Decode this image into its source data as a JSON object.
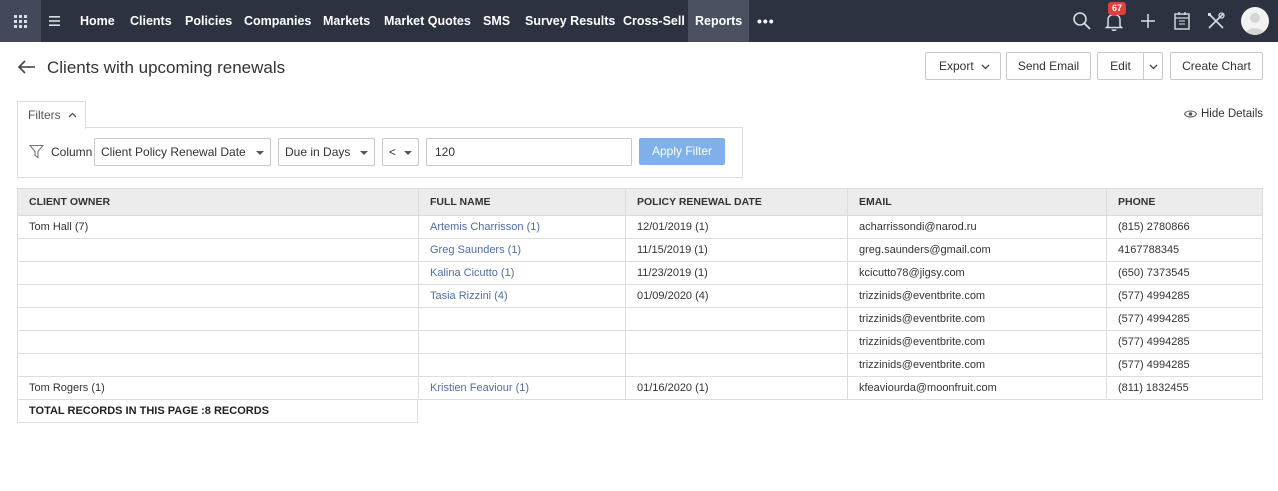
{
  "nav": {
    "items": [
      {
        "label": "Home"
      },
      {
        "label": "Clients"
      },
      {
        "label": "Policies"
      },
      {
        "label": "Companies"
      },
      {
        "label": "Markets"
      },
      {
        "label": "Market Quotes"
      },
      {
        "label": "SMS"
      },
      {
        "label": "Survey Results"
      },
      {
        "label": "Cross-Sell"
      },
      {
        "label": "Reports",
        "active": true
      }
    ],
    "more": "•••",
    "notification_count": "67",
    "colors": {
      "bar": "#2d3241",
      "active": "#4a5060",
      "badge": "#e0403a"
    }
  },
  "header": {
    "title": "Clients with upcoming renewals",
    "buttons": {
      "export": "Export",
      "send_email": "Send Email",
      "edit": "Edit",
      "create_chart": "Create Chart"
    }
  },
  "filters": {
    "tab_label": "Filters",
    "column_label": "Column",
    "column_select": "Client Policy Renewal Date",
    "condition_select": "Due in Days",
    "operator_select": "<",
    "value": "120",
    "apply_label": "Apply Filter",
    "hide_details": "Hide Details"
  },
  "table": {
    "columns": [
      "CLIENT OWNER",
      "FULL NAME",
      "POLICY RENEWAL DATE",
      "EMAIL",
      "PHONE"
    ],
    "rows": [
      [
        "Tom Hall (7)",
        "Artemis Charrisson (1)",
        "12/01/2019 (1)",
        "acharrissondi@narod.ru",
        "(815) 2780866"
      ],
      [
        "",
        "Greg Saunders (1)",
        "11/15/2019 (1)",
        "greg.saunders@gmail.com",
        "4167788345"
      ],
      [
        "",
        "Kalina Cicutto (1)",
        "11/23/2019 (1)",
        "kcicutto78@jigsy.com",
        "(650) 7373545"
      ],
      [
        "",
        "Tasia Rizzini (4)",
        "01/09/2020 (4)",
        "trizzinids@eventbrite.com",
        "(577) 4994285"
      ],
      [
        "",
        "",
        "",
        "trizzinids@eventbrite.com",
        "(577) 4994285"
      ],
      [
        "",
        "",
        "",
        "trizzinids@eventbrite.com",
        "(577) 4994285"
      ],
      [
        "",
        "",
        "",
        "trizzinids@eventbrite.com",
        "(577) 4994285"
      ],
      [
        "Tom Rogers (1)",
        "Kristien Feaviour (1)",
        "01/16/2020 (1)",
        "kfeaviourda@moonfruit.com",
        "(811) 1832455"
      ]
    ],
    "total": "TOTAL RECORDS IN THIS PAGE :8 RECORDS"
  },
  "icons": [
    "apps-grid-icon",
    "hamburger-menu-icon",
    "search-icon",
    "bell-icon",
    "plus-icon",
    "calendar-icon",
    "tools-icon",
    "avatar-icon",
    "back-arrow-icon",
    "filter-funnel-icon",
    "eye-icon",
    "chevron-down-icon",
    "chevron-up-icon"
  ]
}
